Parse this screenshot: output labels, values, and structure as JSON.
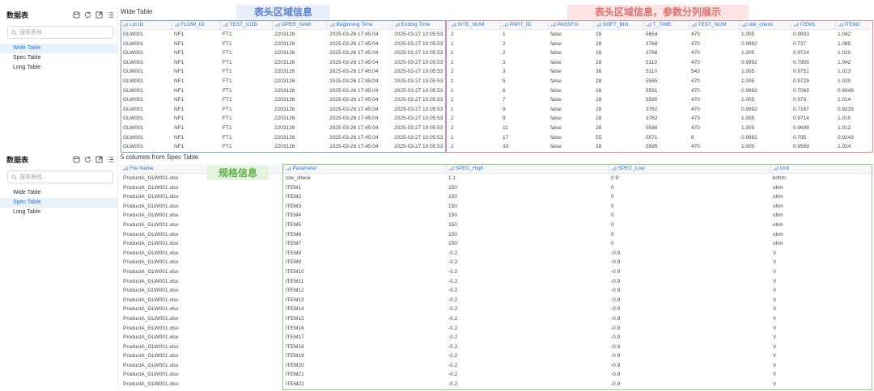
{
  "sidebar_top": {
    "title": "数据表",
    "search_placeholder": "搜索表格",
    "items": [
      {
        "label": "Wide Table",
        "active": true
      },
      {
        "label": "Spec Table",
        "active": false
      },
      {
        "label": "Long Table",
        "active": false
      }
    ]
  },
  "sidebar_bottom": {
    "title": "数据表",
    "search_placeholder": "搜索表格",
    "items": [
      {
        "label": "Wide Table",
        "active": false
      },
      {
        "label": "Spec Table",
        "active": true
      },
      {
        "label": "Long Table",
        "active": false
      }
    ]
  },
  "wide_table": {
    "title": "Wide Table",
    "columns": [
      "Lot ID",
      "FLOW_ID",
      "TEST_COD",
      "OPER_NAM",
      "Beginning Time",
      "Ending Time",
      "SITE_NUM",
      "PART_ID",
      "PASSFG",
      "SOFT_BIN",
      "T_TIME",
      "TEST_NUM",
      "site_check",
      "ITEM1",
      "ITEM2"
    ],
    "rows": [
      [
        "GLW001",
        "NF1",
        "FT1",
        "2203126",
        "2025-03-26 17:45:04",
        "2025-03-27 10:05:53",
        "2",
        "1",
        "false",
        "28",
        "5654",
        "470",
        "1.005",
        "0.9833",
        "1.042"
      ],
      [
        "GLW001",
        "NF1",
        "FT1",
        "2203126",
        "2025-03-26 17:45:04",
        "2025-03-27 10:05:53",
        "1",
        "2",
        "false",
        "28",
        "3768",
        "470",
        "0.9992",
        "0.737",
        "1.085"
      ],
      [
        "GLW001",
        "NF1",
        "FT1",
        "2203126",
        "2025-03-26 17:45:04",
        "2025-03-27 10:05:53",
        "2",
        "2",
        "false",
        "28",
        "3768",
        "470",
        "1.005",
        "0.9724",
        "1.020"
      ],
      [
        "GLW001",
        "NF1",
        "FT1",
        "2203126",
        "2025-03-26 17:45:04",
        "2025-03-27 10:05:53",
        "1",
        "3",
        "false",
        "28",
        "5110",
        "470",
        "0.9992",
        "0.7905",
        "1.042"
      ],
      [
        "GLW001",
        "NF1",
        "FT1",
        "2203126",
        "2025-03-26 17:45:04",
        "2025-03-27 10:05:53",
        "2",
        "3",
        "false",
        "36",
        "5110",
        "543",
        "1.005",
        "0.9751",
        "1.023"
      ],
      [
        "GLW001",
        "NF1",
        "FT1",
        "2203126",
        "2025-03-26 17:45:04",
        "2025-03-27 10:05:53",
        "2",
        "5",
        "false",
        "28",
        "5585",
        "470",
        "1.005",
        "0.9729",
        "1.020"
      ],
      [
        "GLW001",
        "NF1",
        "FT1",
        "2203126",
        "2025-03-26 17:45:04",
        "2025-03-27 10:05:53",
        "1",
        "6",
        "false",
        "28",
        "5591",
        "470",
        "0.9992",
        "0.7065",
        "0.9949"
      ],
      [
        "GLW001",
        "NF1",
        "FT1",
        "2203126",
        "2025-03-26 17:45:04",
        "2025-03-27 10:05:53",
        "2",
        "7",
        "false",
        "28",
        "5590",
        "470",
        "1.005",
        "0.973",
        "1.014"
      ],
      [
        "GLW001",
        "NF1",
        "FT1",
        "2203126",
        "2025-03-26 17:45:04",
        "2025-03-27 10:05:53",
        "1",
        "9",
        "false",
        "28",
        "3762",
        "470",
        "0.9992",
        "0.7167",
        "0.9233"
      ],
      [
        "GLW001",
        "NF1",
        "FT1",
        "2203126",
        "2025-03-26 17:45:04",
        "2025-03-27 10:05:53",
        "2",
        "9",
        "false",
        "28",
        "3762",
        "470",
        "1.005",
        "0.9714",
        "1.010"
      ],
      [
        "GLW001",
        "NF1",
        "FT1",
        "2203126",
        "2025-03-26 17:45:04",
        "2025-03-27 10:05:53",
        "2",
        "11",
        "false",
        "28",
        "5588",
        "470",
        "1.005",
        "0.9698",
        "1.012"
      ],
      [
        "GLW001",
        "NF1",
        "FT1",
        "2203126",
        "2025-03-26 17:45:04",
        "2025-03-27 10:05:53",
        "1",
        "17",
        "false",
        "55",
        "5571",
        "8",
        "0.9992",
        "0.795",
        "0.9243"
      ],
      [
        "GLW001",
        "NF1",
        "FT1",
        "2203126",
        "2025-03-26 17:45:04",
        "2025-03-27 10:05:53",
        "2",
        "33",
        "false",
        "28",
        "5595",
        "470",
        "1.005",
        "0.9569",
        "1.024"
      ]
    ]
  },
  "spec_table": {
    "title": "5 columns from Spec Table",
    "columns": [
      "File Name",
      "Parameter",
      "SPEC_High",
      "SPEC_Low",
      "Unit"
    ],
    "rows": [
      [
        "ProductA_GLW001.xlsx",
        "site_check",
        "1.1",
        "0.9",
        "kohm"
      ],
      [
        "ProductA_GLW001.xlsx",
        "ITEM1",
        "150",
        "0",
        "ohm"
      ],
      [
        "ProductA_GLW001.xlsx",
        "ITEM2",
        "150",
        "0",
        "ohm"
      ],
      [
        "ProductA_GLW001.xlsx",
        "ITEM3",
        "150",
        "0",
        "ohm"
      ],
      [
        "ProductA_GLW001.xlsx",
        "ITEM4",
        "150",
        "0",
        "ohm"
      ],
      [
        "ProductA_GLW001.xlsx",
        "ITEM5",
        "150",
        "0",
        "ohm"
      ],
      [
        "ProductA_GLW001.xlsx",
        "ITEM6",
        "150",
        "0",
        "ohm"
      ],
      [
        "ProductA_GLW001.xlsx",
        "ITEM7",
        "150",
        "0",
        "ohm"
      ],
      [
        "ProductA_GLW001.xlsx",
        "ITEM8",
        "-0.2",
        "-0.9",
        "V"
      ],
      [
        "ProductA_GLW001.xlsx",
        "ITEM9",
        "-0.2",
        "-0.9",
        "V"
      ],
      [
        "ProductA_GLW001.xlsx",
        "ITEM10",
        "-0.2",
        "-0.9",
        "V"
      ],
      [
        "ProductA_GLW001.xlsx",
        "ITEM11",
        "-0.2",
        "-0.9",
        "V"
      ],
      [
        "ProductA_GLW001.xlsx",
        "ITEM12",
        "-0.2",
        "-0.9",
        "V"
      ],
      [
        "ProductA_GLW001.xlsx",
        "ITEM13",
        "-0.2",
        "-0.9",
        "V"
      ],
      [
        "ProductA_GLW001.xlsx",
        "ITEM14",
        "-0.2",
        "-0.9",
        "V"
      ],
      [
        "ProductA_GLW001.xlsx",
        "ITEM15",
        "-0.2",
        "-0.9",
        "V"
      ],
      [
        "ProductA_GLW001.xlsx",
        "ITEM16",
        "-0.2",
        "-0.9",
        "V"
      ],
      [
        "ProductA_GLW001.xlsx",
        "ITEM17",
        "-0.2",
        "-0.9",
        "V"
      ],
      [
        "ProductA_GLW001.xlsx",
        "ITEM18",
        "-0.2",
        "-0.9",
        "V"
      ],
      [
        "ProductA_GLW001.xlsx",
        "ITEM19",
        "-0.2",
        "-0.9",
        "V"
      ],
      [
        "ProductA_GLW001.xlsx",
        "ITEM20",
        "-0.2",
        "-0.9",
        "V"
      ],
      [
        "ProductA_GLW001.xlsx",
        "ITEM21",
        "-0.2",
        "-0.9",
        "V"
      ],
      [
        "ProductA_GLW001.xlsx",
        "ITEM22",
        "-0.2",
        "-0.9",
        "V"
      ]
    ]
  },
  "annotations": {
    "header_info": "表头区域信息",
    "header_params": "表头区域信息，参数分列展示",
    "spec_info": "规格信息"
  },
  "icons": {
    "sidebar": [
      "database-icon",
      "refresh-icon",
      "export-icon",
      "list-settings-icon"
    ],
    "search": "search-icon",
    "column": "column-type-icon"
  },
  "colors": {
    "accent": "#2a74d8",
    "active_bg": "#e8f2fd",
    "blue_box": "#7b9bd6",
    "red_box": "#e5898a",
    "green_box": "#8ccf7e"
  }
}
